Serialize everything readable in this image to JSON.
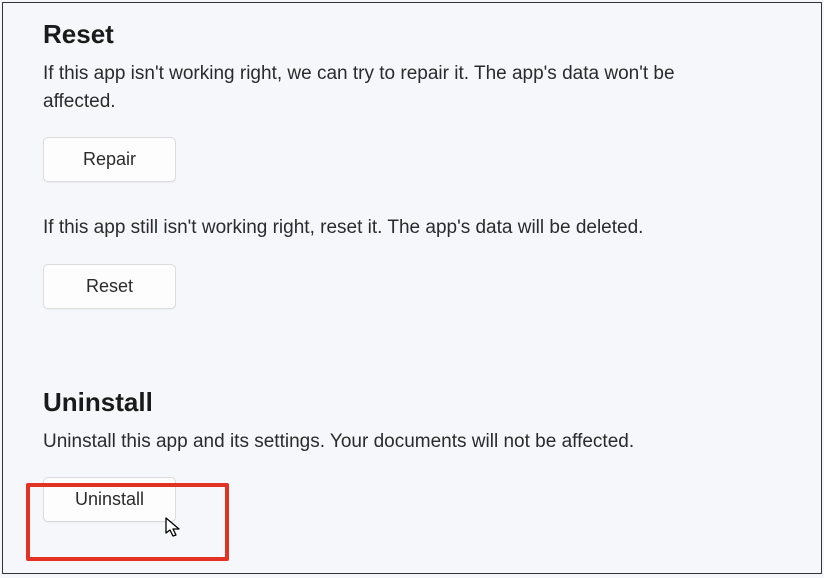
{
  "reset": {
    "heading": "Reset",
    "repair_description": "If this app isn't working right, we can try to repair it. The app's data won't be affected.",
    "repair_button": "Repair",
    "reset_description": "If this app still isn't working right, reset it. The app's data will be deleted.",
    "reset_button": "Reset"
  },
  "uninstall": {
    "heading": "Uninstall",
    "description": "Uninstall this app and its settings. Your documents will not be affected.",
    "button": "Uninstall"
  }
}
